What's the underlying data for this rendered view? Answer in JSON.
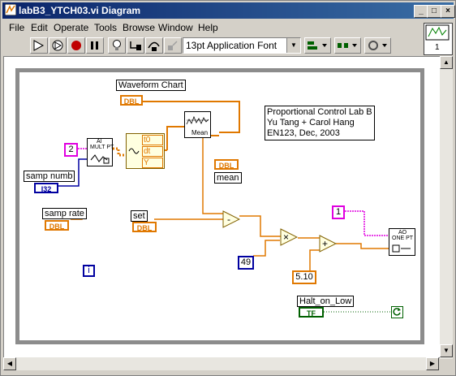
{
  "window": {
    "title": "labB3_YTCH03.vi Diagram"
  },
  "titlebar_buttons": {
    "minimize": "_",
    "maximize": "□",
    "close": "×"
  },
  "menu": [
    "File",
    "Edit",
    "Operate",
    "Tools",
    "Browse",
    "Window",
    "Help"
  ],
  "toolbar": {
    "font": "13pt Application Font"
  },
  "connector_pane": {
    "number": "1"
  },
  "diagram": {
    "chart_label": "Waveform Chart",
    "chart_term": "DBL",
    "comment_lines": [
      "Proportional Control Lab B",
      "Yu Tang + Carol Hang",
      "EN123, Dec,  2003"
    ],
    "const_2": "2",
    "ai_node": [
      "AI",
      "MULT PT"
    ],
    "samp_numb_label": "samp numb",
    "samp_numb_term": "I32",
    "samp_rate_label": "samp rate",
    "samp_rate_term": "DBL",
    "waveform_ports": [
      "t0",
      "dt",
      "Y"
    ],
    "mean_node": "Mean",
    "mean_term": "DBL",
    "mean_label": "mean",
    "set_label": "set",
    "set_term": "DBL",
    "subtract_symbol": "-",
    "multiply_symbol": "×",
    "add_symbol": "+",
    "const_49": "49",
    "const_5_10": "5.10",
    "const_1": "1",
    "ao_node": [
      "AO",
      "ONE PT"
    ],
    "iteration_term": "i",
    "halt_label": "Halt_on_Low",
    "halt_term": "TF"
  },
  "colors": {
    "dbl": "#e07800",
    "i32": "#0000a0",
    "pink": "#e000e0",
    "bool": "#006000",
    "frame": "#8c8c8c"
  }
}
